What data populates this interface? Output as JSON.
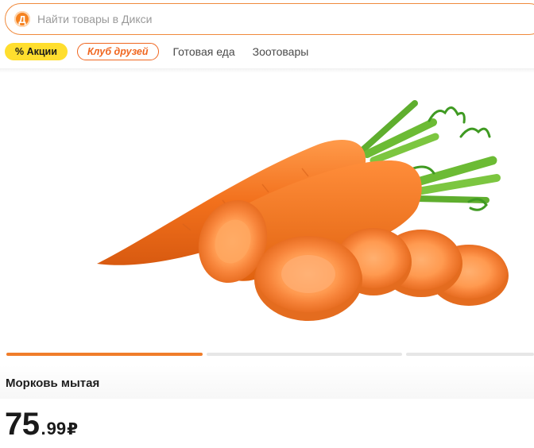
{
  "search": {
    "logo_letter": "Д",
    "placeholder": "Найти товары в Дикси"
  },
  "chips": {
    "promo": "% Акции",
    "club": "Клуб друзей",
    "links": [
      "Готовая еда",
      "Зоотовары"
    ]
  },
  "colors": {
    "brand_orange": "#f58220",
    "promo_yellow": "#ffde2e",
    "club_orange": "#f0661f",
    "carousel_active": "#f07d2a"
  },
  "product": {
    "image": "carrot-photo",
    "title": "Морковь мытая",
    "price_main": "75",
    "price_sep": ".",
    "price_cents": "99",
    "currency": "₽"
  },
  "carousel": {
    "total": 3,
    "active_index": 0
  }
}
